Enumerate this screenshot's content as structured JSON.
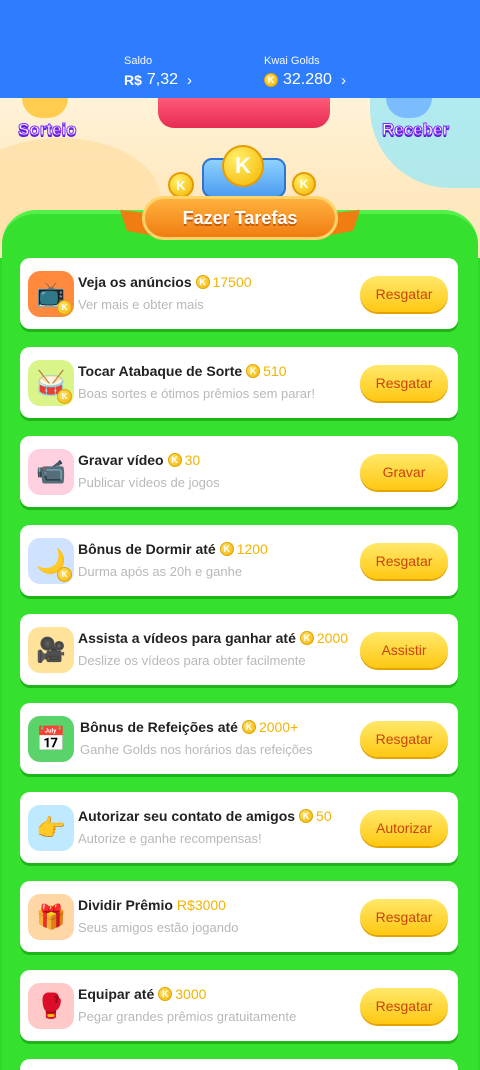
{
  "header": {
    "saldo_label": "Saldo",
    "saldo_currency": "R$",
    "saldo_value": "7,32",
    "golds_label": "Kwai Golds",
    "golds_value": "32.280",
    "chevron": "›"
  },
  "banner": {
    "left_label": "Sorteio",
    "right_label": "Receber",
    "ribbon_title": "Fazer Tarefas",
    "coin_letter": "K"
  },
  "tasks": [
    {
      "title": "Veja os anúncios",
      "reward": "17500",
      "reward_type": "coin",
      "subtitle": "Ver mais e obter mais",
      "button": "Resgatar",
      "icon": "tv-icon"
    },
    {
      "title": "Tocar Atabaque de Sorte",
      "reward": "510",
      "reward_type": "coin",
      "subtitle": "Boas sortes e ótimos prêmios sem parar!",
      "button": "Resgatar",
      "icon": "drum-icon"
    },
    {
      "title": "Gravar vídeo",
      "reward": "30",
      "reward_type": "coin",
      "subtitle": "Publicar vídeos de jogos",
      "button": "Gravar",
      "icon": "camera-icon"
    },
    {
      "title": "Bônus de Dormir até",
      "reward": "1200",
      "reward_type": "coin",
      "subtitle": "Durma após as 20h e ganhe",
      "button": "Resgatar",
      "icon": "moon-icon"
    },
    {
      "title": "Assista a vídeos para ganhar até",
      "reward": "2000",
      "reward_type": "coin",
      "subtitle": "Deslize os vídeos para obter facilmente",
      "button": "Assistir",
      "icon": "video-camera-icon"
    },
    {
      "title": "Bônus de Refeições até",
      "reward": "2000+",
      "reward_type": "coin",
      "subtitle": "Ganhe Golds nos horários das refeições",
      "button": "Resgatar",
      "icon": "calendar-icon"
    },
    {
      "title": "Autorizar seu contato de amigos",
      "reward": "50",
      "reward_type": "coin",
      "subtitle": "Autorize e ganhe recompensas!",
      "button": "Autorizar",
      "icon": "hand-icon"
    },
    {
      "title": "Dividir Prêmio",
      "reward": "R$3000",
      "reward_type": "money",
      "subtitle": "Seus amigos estão jogando",
      "button": "Resgatar",
      "icon": "gift-icon"
    },
    {
      "title": "Equipar até",
      "reward": "3000",
      "reward_type": "coin",
      "subtitle": "Pegar grandes prêmios gratuitamente",
      "button": "Resgatar",
      "icon": "gloves-icon"
    }
  ],
  "colors": {
    "topbar": "#2f7dff",
    "panel_green": "#36e02f",
    "button_yellow": "#ffd43a",
    "button_text": "#c9430b",
    "coin_gold": "#f2b300"
  }
}
